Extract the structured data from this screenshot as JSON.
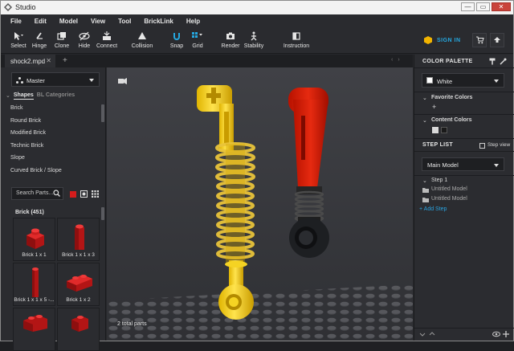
{
  "window": {
    "title": "Studio",
    "buttons": {
      "minimize": "—",
      "maximize": "▭",
      "close": "✕"
    }
  },
  "menu": [
    "File",
    "Edit",
    "Model",
    "View",
    "Tool",
    "BrickLink",
    "Help"
  ],
  "toolbar": {
    "tools": [
      {
        "label": "Select",
        "icon": "select-arrow-icon"
      },
      {
        "label": "Hinge",
        "icon": "hinge-icon"
      },
      {
        "label": "Clone",
        "icon": "clone-icon"
      },
      {
        "label": "Hide",
        "icon": "hide-eye-icon"
      },
      {
        "label": "Connect",
        "icon": "connect-icon"
      },
      {
        "label": "Collision",
        "icon": "collision-icon"
      },
      {
        "label": "Snap",
        "icon": "snap-icon"
      },
      {
        "label": "Grid",
        "icon": "grid-icon"
      },
      {
        "label": "Render",
        "icon": "camera-icon"
      },
      {
        "label": "Stability",
        "icon": "stability-icon"
      },
      {
        "label": "Instruction",
        "icon": "instruction-icon"
      }
    ],
    "sign_in": "SIGN IN",
    "accent": "#25a8e0"
  },
  "tabs": {
    "active": "shock2.mpd",
    "close": "✕",
    "add": "+"
  },
  "left": {
    "model_select": "Master",
    "palette_tabs": {
      "active": "Shapes",
      "inactive": "BL Categories"
    },
    "categories": [
      "Brick",
      "Round Brick",
      "Modified Brick",
      "Technic Brick",
      "Slope",
      "Curved Brick / Slope"
    ],
    "search_placeholder": "Search Parts...",
    "selected_color": "#d41c1c",
    "group_header": "Brick (451)",
    "parts": [
      "Brick 1 x 1",
      "Brick 1 x 1 x 3",
      "Brick 1 x 1 x 5 -...",
      "Brick 1 x 2",
      "",
      ""
    ]
  },
  "viewport": {
    "status": "2 total parts"
  },
  "right": {
    "color_palette_title": "COLOR PALETTE",
    "current_color": "White",
    "favorite_colors": "Favorite Colors",
    "favorite_add": "+",
    "content_colors": "Content Colors",
    "content_swatches": [
      "#d9d9d9",
      "#1a1a1a"
    ],
    "step_list_title": "STEP LIST",
    "step_view_label": "Step view",
    "model_dropdown": "Main Model",
    "step": "Step 1",
    "untitled_models": [
      "Untitled Model",
      "Untitled Model"
    ],
    "add_step": "+ Add Step"
  }
}
